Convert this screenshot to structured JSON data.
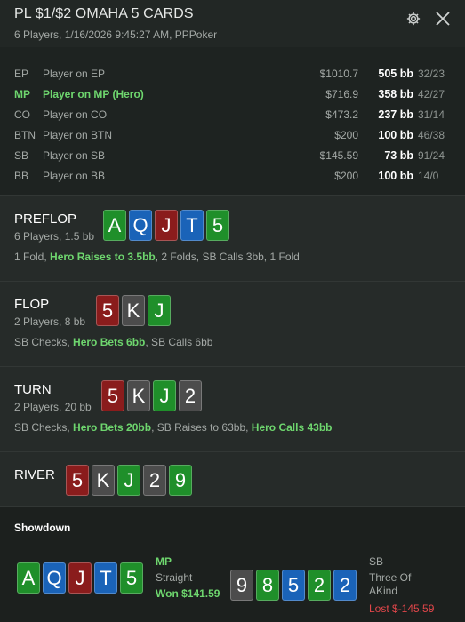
{
  "header": {
    "title": "PL $1/$2 OMAHA 5 CARDS",
    "subtitle": "6 Players, 1/16/2026 9:45:27 AM, PPPoker"
  },
  "players": [
    {
      "pos": "EP",
      "name": "Player on EP",
      "stack": "$1010.7",
      "bb": "505 bb",
      "stats": "32/23"
    },
    {
      "pos": "MP",
      "name": "Player on MP (Hero)",
      "stack": "$716.9",
      "bb": "358 bb",
      "stats": "42/27"
    },
    {
      "pos": "CO",
      "name": "Player on CO",
      "stack": "$473.2",
      "bb": "237 bb",
      "stats": "31/14"
    },
    {
      "pos": "BTN",
      "name": "Player on BTN",
      "stack": "$200",
      "bb": "100 bb",
      "stats": "46/38"
    },
    {
      "pos": "SB",
      "name": "Player on SB",
      "stack": "$145.59",
      "bb": "73 bb",
      "stats": "91/24"
    },
    {
      "pos": "BB",
      "name": "Player on BB",
      "stack": "$200",
      "bb": "100 bb",
      "stats": "14/0"
    }
  ],
  "preflop": {
    "name": "PREFLOP",
    "info": "6 Players, 1.5 bb",
    "cards": [
      "A",
      "Q",
      "J",
      "T",
      "5"
    ],
    "actions": {
      "a1": "1 Fold, ",
      "hero": "Hero Raises to 3.5bb",
      "a2": ", 2 Folds, SB Calls 3bb, 1 Fold"
    }
  },
  "flop": {
    "name": "FLOP",
    "info": "2 Players, 8 bb",
    "cards": [
      "5",
      "K",
      "J"
    ],
    "actions": {
      "a1": "SB Checks, ",
      "hero": "Hero Bets 6bb",
      "a2": ", SB Calls 6bb"
    }
  },
  "turn": {
    "name": "TURN",
    "info": "2 Players, 20 bb",
    "cards": [
      "5",
      "K",
      "J",
      "2"
    ],
    "actions": {
      "a1": "SB Checks, ",
      "hero": "Hero Bets 20bb",
      "a2": ", SB Raises to 63bb, ",
      "hero2": "Hero Calls 43bb"
    }
  },
  "river": {
    "name": "RIVER",
    "cards": [
      "5",
      "K",
      "J",
      "2",
      "9"
    ]
  },
  "showdown": {
    "title": "Showdown",
    "hero": {
      "cards": [
        "A",
        "Q",
        "J",
        "T",
        "5"
      ],
      "pos": "MP",
      "hand": "Straight",
      "result": "Won $141.59"
    },
    "villain": {
      "cards": [
        "9",
        "8",
        "5",
        "2",
        "2"
      ],
      "pos": "SB",
      "hand_line1": "Three Of",
      "hand_line2": "AKind",
      "result": "Lost $-145.59"
    }
  },
  "colors": {
    "hero_green": "#6ed66e",
    "loss_red": "#e0464a",
    "card_green": "#1f8f2a",
    "card_red": "#8a1c1c",
    "card_blue": "#1a63b8",
    "card_gray": "#4c4c4c"
  },
  "icons": [
    "gear-icon",
    "close-icon"
  ]
}
